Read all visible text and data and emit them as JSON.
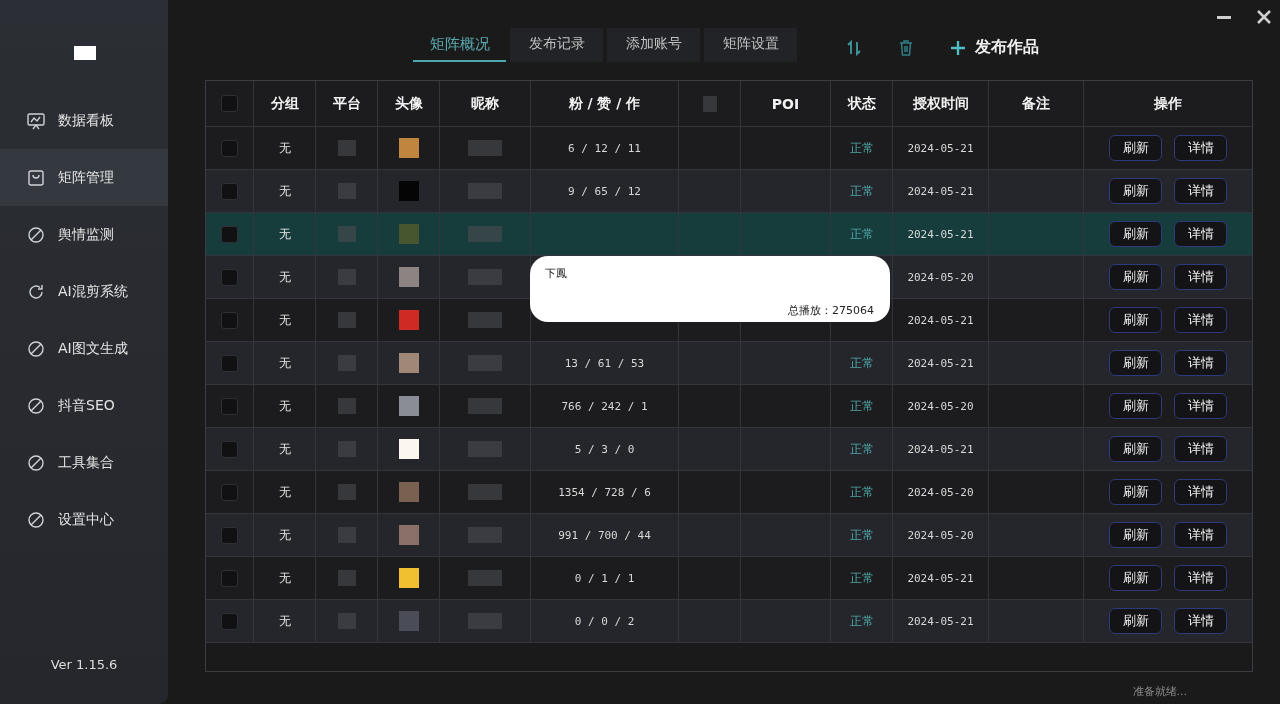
{
  "sidebar": {
    "items": [
      {
        "label": "数据看板",
        "kind": "monitor",
        "selected": false
      },
      {
        "label": "矩阵管理",
        "kind": "bag",
        "selected": true
      },
      {
        "label": "舆情监测",
        "kind": "blocked",
        "selected": false
      },
      {
        "label": "AI混剪系统",
        "kind": "cycle",
        "selected": false
      },
      {
        "label": "AI图文生成",
        "kind": "blocked",
        "selected": false
      },
      {
        "label": "抖音SEO",
        "kind": "blocked",
        "selected": false
      },
      {
        "label": "工具集合",
        "kind": "blocked",
        "selected": false
      },
      {
        "label": "设置中心",
        "kind": "blocked",
        "selected": false
      }
    ],
    "version": "Ver 1.15.6"
  },
  "tabs": [
    {
      "label": "矩阵概况",
      "selected": true
    },
    {
      "label": "发布记录",
      "selected": false
    },
    {
      "label": "添加账号",
      "selected": false
    },
    {
      "label": "矩阵设置",
      "selected": false
    }
  ],
  "toolbar": {
    "publish_button": "发布作品"
  },
  "table": {
    "select_all_checked": false,
    "columns": [
      "分组",
      "平台",
      "头像",
      "昵称",
      "粉 / 赞 / 作",
      "",
      "POI",
      "状态",
      "授权时间",
      "备注",
      "操作"
    ],
    "rows": [
      {
        "checked": false,
        "group": "无",
        "color": "#c0853e",
        "stats": "6 / 12 / 11",
        "status": "正常",
        "date": "2024-05-21",
        "highlighted": false,
        "actions": [
          "刷新",
          "详情"
        ]
      },
      {
        "checked": false,
        "group": "无",
        "color": "#050505",
        "stats": "9 / 65 / 12",
        "status": "正常",
        "date": "2024-05-21",
        "highlighted": false,
        "actions": [
          "刷新",
          "详情"
        ]
      },
      {
        "checked": false,
        "group": "无",
        "color": "#47562f",
        "status": "正常",
        "date": "2024-05-21",
        "highlighted": true,
        "actions": [
          "刷新",
          "详情"
        ]
      },
      {
        "checked": false,
        "group": "无",
        "color": "#8c8482",
        "date": "2024-05-20",
        "highlighted": false,
        "actions": [
          "刷新",
          "详情"
        ]
      },
      {
        "checked": false,
        "group": "无",
        "color": "#d02a24",
        "date": "2024-05-21",
        "highlighted": false,
        "actions": [
          "刷新",
          "详情"
        ]
      },
      {
        "checked": false,
        "group": "无",
        "color": "#a08878",
        "stats": "13 / 61 / 53",
        "status": "正常",
        "date": "2024-05-21",
        "highlighted": false,
        "actions": [
          "刷新",
          "详情"
        ]
      },
      {
        "checked": false,
        "group": "无",
        "color": "#8a8d96",
        "stats": "766 / 242 / 1",
        "status": "正常",
        "date": "2024-05-20",
        "highlighted": false,
        "actions": [
          "刷新",
          "详情"
        ]
      },
      {
        "checked": false,
        "group": "无",
        "color": "#fbf6ee",
        "stats": "5 / 3 / 0",
        "status": "正常",
        "date": "2024-05-21",
        "highlighted": false,
        "actions": [
          "刷新",
          "详情"
        ]
      },
      {
        "checked": false,
        "group": "无",
        "color": "#7a6050",
        "stats": "1354 / 728 / 6",
        "status": "正常",
        "date": "2024-05-20",
        "highlighted": false,
        "actions": [
          "刷新",
          "详情"
        ]
      },
      {
        "checked": false,
        "group": "无",
        "color": "#8a7068",
        "stats": "991 / 700 / 44",
        "status": "正常",
        "date": "2024-05-20",
        "highlighted": false,
        "actions": [
          "刷新",
          "详情"
        ]
      },
      {
        "checked": false,
        "group": "无",
        "color": "#f0c030",
        "stats": "0 / 1 / 1",
        "status": "正常",
        "date": "2024-05-21",
        "highlighted": false,
        "actions": [
          "刷新",
          "详情"
        ]
      },
      {
        "checked": false,
        "group": "无",
        "color": "#4a4c58",
        "stats": "0 / 0 / 2",
        "status": "正常",
        "date": "2024-05-21",
        "highlighted": false,
        "actions": [
          "刷新",
          "详情"
        ]
      }
    ]
  },
  "tooltip": {
    "lines": [
      "下鳳",
      "总播放：275064"
    ]
  },
  "status_bar": "准备就绪..."
}
